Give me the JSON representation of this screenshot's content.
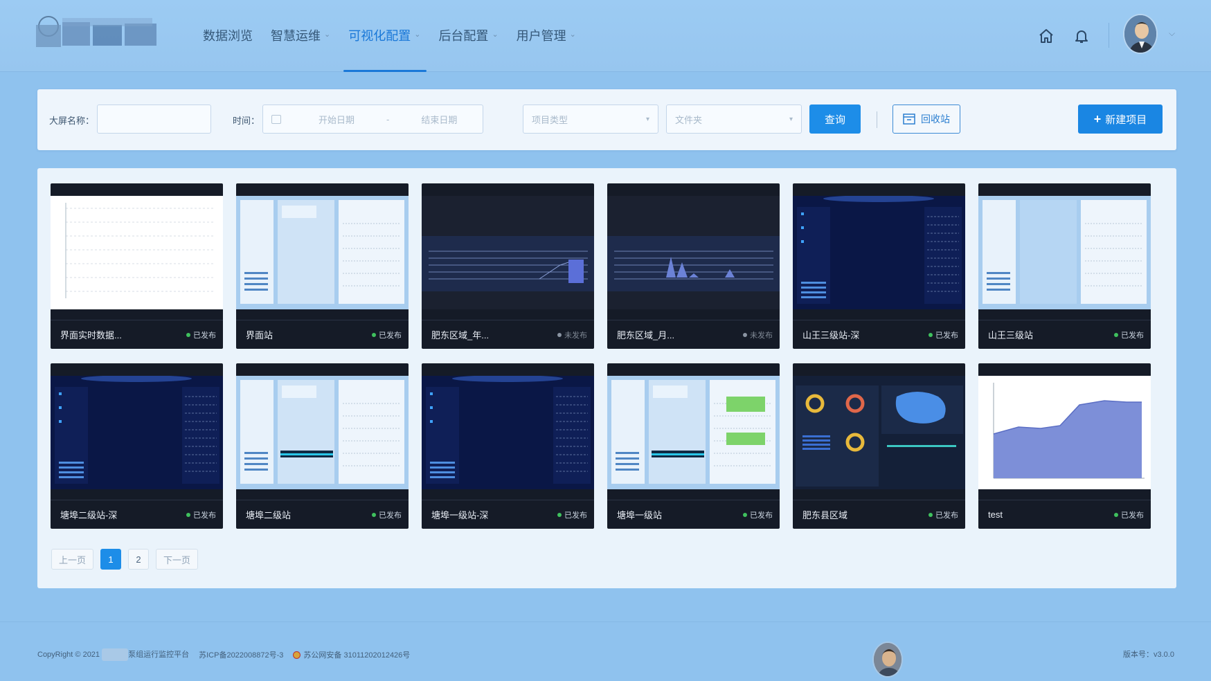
{
  "nav": {
    "items": [
      {
        "label": "数据浏览",
        "has_menu": false,
        "active": false
      },
      {
        "label": "智慧运维",
        "has_menu": true,
        "active": false
      },
      {
        "label": "可视化配置",
        "has_menu": true,
        "active": true
      },
      {
        "label": "后台配置",
        "has_menu": true,
        "active": false
      },
      {
        "label": "用户管理",
        "has_menu": true,
        "active": false
      }
    ],
    "home_icon": "home-icon",
    "bell_icon": "bell-icon",
    "avatar_icon": "user-avatar"
  },
  "filter": {
    "name_label": "大屏名称：",
    "name_value": "",
    "time_label": "时间：",
    "start_placeholder": "开始日期",
    "range_separator": "-",
    "end_placeholder": "结束日期",
    "category_placeholder": "项目类型",
    "folder_placeholder": "文件夹",
    "query_label": "查询",
    "recycle_label": "回收站",
    "new_label": "新建项目"
  },
  "colors": {
    "accent": "#1d8de8",
    "published": "#3fc15e",
    "unpublished": "#8a94a2",
    "card_bg": "#151b27"
  },
  "projects": [
    {
      "name": "界面实时数据...",
      "status": "已发布",
      "published": true,
      "thumb": "white-lines"
    },
    {
      "name": "界面站",
      "status": "已发布",
      "published": true,
      "thumb": "light-dashboard"
    },
    {
      "name": "肥东区域_年...",
      "status": "未发布",
      "published": false,
      "thumb": "dark-chart-bar"
    },
    {
      "name": "肥东区域_月...",
      "status": "未发布",
      "published": false,
      "thumb": "dark-chart-peaks"
    },
    {
      "name": "山王三级站-深",
      "status": "已发布",
      "published": true,
      "thumb": "dark-dashboard"
    },
    {
      "name": "山王三级站",
      "status": "已发布",
      "published": true,
      "thumb": "light-dashboard-b"
    },
    {
      "name": "塘埠二级站-深",
      "status": "已发布",
      "published": true,
      "thumb": "dark-dashboard"
    },
    {
      "name": "塘埠二级站",
      "status": "已发布",
      "published": true,
      "thumb": "light-dashboard-bar"
    },
    {
      "name": "塘埠一级站-深",
      "status": "已发布",
      "published": true,
      "thumb": "dark-dashboard"
    },
    {
      "name": "塘埠一级站",
      "status": "已发布",
      "published": true,
      "thumb": "light-dashboard-green"
    },
    {
      "name": "肥东县区域",
      "status": "已发布",
      "published": true,
      "thumb": "dark-donuts-map"
    },
    {
      "name": "test",
      "status": "已发布",
      "published": true,
      "thumb": "area-chart"
    }
  ],
  "pagination": {
    "prev": "上一页",
    "pages": [
      "1",
      "2"
    ],
    "current": "1",
    "next": "下一页"
  },
  "footer": {
    "copyright": "CopyRight © 2021",
    "platform": "泵组运行监控平台",
    "icp": "苏ICP备2022008872号-3",
    "police": "苏公网安备 31011202012426号",
    "version": "版本号：v3.0.0"
  }
}
